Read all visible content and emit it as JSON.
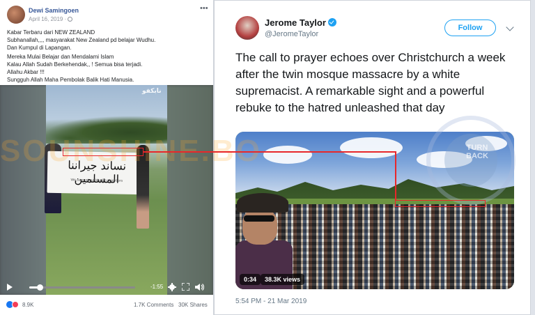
{
  "facebook": {
    "author": "Dewi Samingoen",
    "date": "April 16, 2019 ·",
    "menu_dots": "•••",
    "post_lines": [
      "Kabar Terbaru dari NEW ZEALAND",
      "Subhanallah,,,, masyarakat New Zealand pd belajar Wudhu.",
      "Dan Kumpul di Lapangan.",
      "Mereka Mulai Belajar dan Mendalami Islam",
      "Kalau Allah Sudah Berkehendak,, ! Semua bisa terjadi.",
      "Allahu Akbar !!!",
      "Sungguh Allah Maha Pembolak Balik Hati Manusia."
    ],
    "video": {
      "watermark": "نابكفو",
      "banner_arabic": "نساند جيراننا المسلمين",
      "banner_english": "We support our Muslim neighbors",
      "time_remaining": "-1:55",
      "progress": 0.1
    },
    "reactions_count": "8.9K",
    "comments": "1.7K Comments",
    "shares": "30K Shares"
  },
  "tweet": {
    "name": "Jerome Taylor",
    "handle": "@JeromeTaylor",
    "follow_label": "Follow",
    "text": "The call to prayer echoes over Christchurch a week after the twin mosque massacre by a white supremacist. A remarkable sight and a powerful rebuke to the hatred unleashed that day",
    "video_time": "0:34",
    "video_views": "38.3K views",
    "timestamp": "5:54 PM - 21 Mar 2019"
  },
  "overlay": {
    "watermark_text": "SOUNSHINE.BO",
    "seal_text": "TURN BACK",
    "annotation_color": "#e8272a"
  }
}
